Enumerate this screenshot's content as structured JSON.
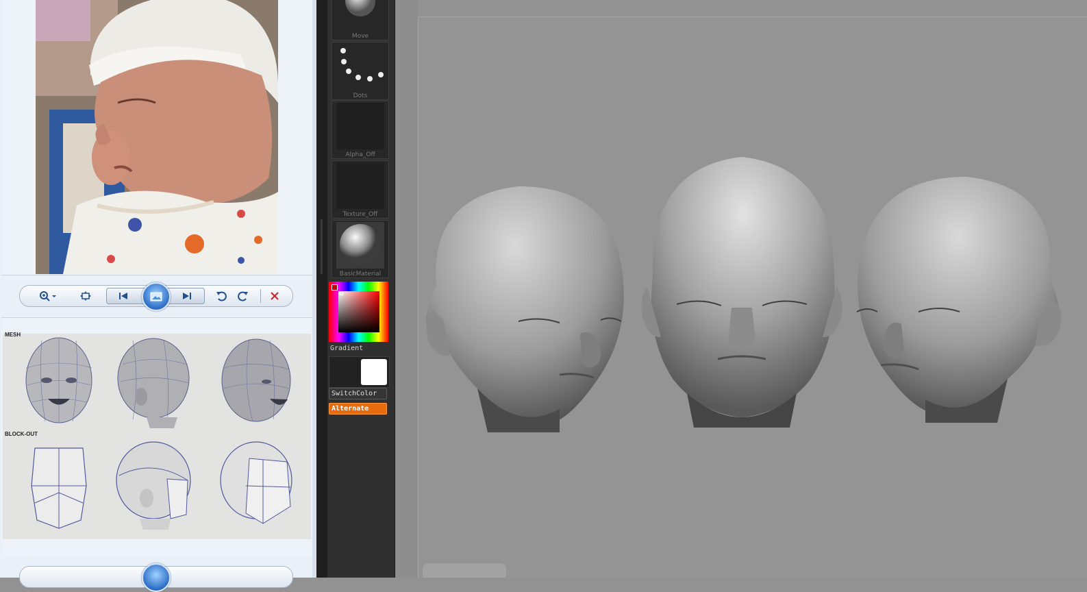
{
  "photo_viewer": {
    "photo_subject": "sleeping newborn baby photo",
    "toolbar": {
      "zoom": "zoom-icon",
      "fit": "fit-to-window-icon",
      "previous": "previous-icon",
      "slideshow": "slideshow-icon",
      "next": "next-icon",
      "rotate_ccw": "rotate-counterclockwise-icon",
      "rotate_cw": "rotate-clockwise-icon",
      "delete": "delete-icon"
    },
    "reference_sheet": {
      "mesh_label": "MESH",
      "blockout_label": "BLOCK-OUT"
    }
  },
  "zbrush_tray": {
    "brush_label": "Move",
    "stroke_label": "Dots",
    "alpha_label": "Alpha_Off",
    "texture_label": "Texture_Off",
    "material_label": "BasicMaterial",
    "gradient_label": "Gradient",
    "switchcolor_label": "SwitchColor",
    "alternate_label": "Alternate",
    "colors": {
      "main_color": "#ffffff",
      "alternate_active": "#e56b0d"
    }
  },
  "canvas": {
    "background": "#949494",
    "models": [
      "baby-head-three-quarter-left",
      "baby-head-front",
      "baby-head-three-quarter-right"
    ]
  }
}
